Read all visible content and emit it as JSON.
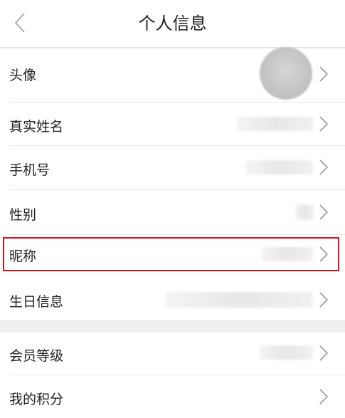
{
  "header": {
    "title": "个人信息",
    "back_icon": "chevron-left-icon"
  },
  "profile": {
    "items": [
      {
        "id": "avatar",
        "label": "头像",
        "value_type": "avatar-image",
        "icon": "chevron-right-icon"
      },
      {
        "id": "real-name",
        "label": "真实姓名",
        "value_type": "blurred",
        "icon": "chevron-right-icon"
      },
      {
        "id": "phone",
        "label": "手机号",
        "value_type": "blurred",
        "icon": "chevron-right-icon"
      },
      {
        "id": "gender",
        "label": "性别",
        "value_type": "blurred",
        "icon": "chevron-right-icon"
      },
      {
        "id": "nickname",
        "label": "昵称",
        "value_type": "blurred",
        "icon": "chevron-right-icon",
        "highlighted": true
      },
      {
        "id": "birthday",
        "label": "生日信息",
        "value_type": "blurred",
        "icon": "chevron-right-icon"
      }
    ]
  },
  "account": {
    "items": [
      {
        "id": "member-level",
        "label": "会员等级",
        "value_type": "blurred",
        "icon": "chevron-right-icon"
      },
      {
        "id": "points",
        "label": "我的积分",
        "value_type": "none",
        "icon": "chevron-right-icon"
      }
    ]
  },
  "colors": {
    "highlight_border": "#d6121e",
    "divider": "#e8e8e8",
    "section_gap": "#efefef",
    "chevron": "#9b9b9b"
  }
}
